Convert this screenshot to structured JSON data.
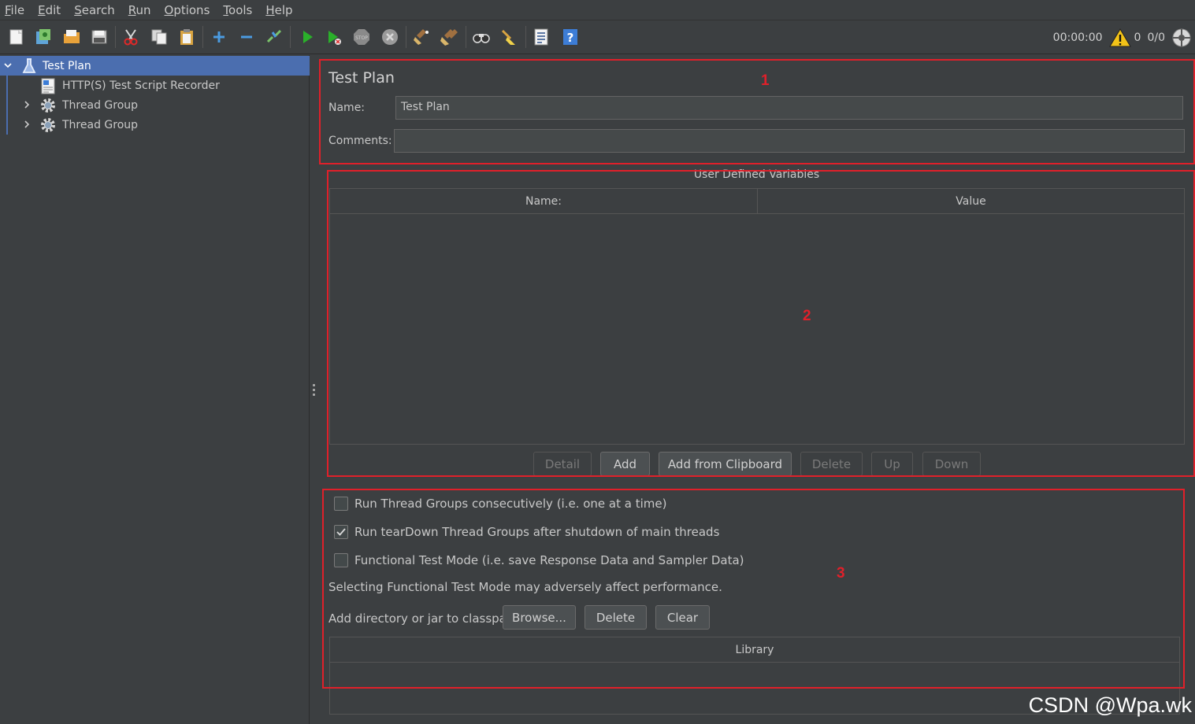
{
  "menu": [
    {
      "mnemonic": "F",
      "rest": "ile"
    },
    {
      "mnemonic": "E",
      "rest": "dit"
    },
    {
      "mnemonic": "S",
      "rest": "earch"
    },
    {
      "mnemonic": "R",
      "rest": "un"
    },
    {
      "mnemonic": "O",
      "rest": "ptions"
    },
    {
      "mnemonic": "T",
      "rest": "ools"
    },
    {
      "mnemonic": "H",
      "rest": "elp"
    }
  ],
  "toolbar": {
    "icons": [
      "new-icon",
      "templates-icon",
      "open-icon",
      "save-icon",
      "cut-icon",
      "copy-icon",
      "paste-icon",
      "expand-icon",
      "collapse-icon",
      "toggle-icon",
      "start-icon",
      "start-no-pause-icon",
      "stop-icon",
      "shutdown-icon",
      "clear-icon",
      "clear-all-icon",
      "search-icon",
      "reset-search-icon",
      "function-helper-icon",
      "help-icon"
    ]
  },
  "status": {
    "timer": "00:00:00",
    "warning_count": "0",
    "threads": "0/0"
  },
  "tree": {
    "items": [
      {
        "label": "Test Plan"
      },
      {
        "label": "HTTP(S) Test Script Recorder"
      },
      {
        "label": "Thread Group"
      },
      {
        "label": "Thread Group"
      }
    ]
  },
  "panel": {
    "title": "Test Plan",
    "name_label": "Name:",
    "name_value": "Test Plan",
    "comments_label": "Comments:",
    "comments_value": ""
  },
  "udv": {
    "title": "User Defined Variables",
    "columns": [
      "Name:",
      "Value"
    ],
    "buttons": {
      "detail": "Detail",
      "add": "Add",
      "add_clipboard": "Add from Clipboard",
      "delete": "Delete",
      "up": "Up",
      "down": "Down"
    }
  },
  "options": {
    "run_consecutively": {
      "label": "Run Thread Groups consecutively (i.e. one at a time)",
      "checked": false
    },
    "run_teardown": {
      "label": "Run tearDown Thread Groups after shutdown of main threads",
      "checked": true
    },
    "functional_mode": {
      "label": "Functional Test Mode (i.e. save Response Data and Sampler Data)",
      "checked": false
    },
    "functional_note": "Selecting Functional Test Mode may adversely affect performance.",
    "classpath_label": "Add directory or jar to classpath",
    "browse": "Browse...",
    "delete": "Delete",
    "clear": "Clear",
    "library_column": "Library"
  },
  "annotations": {
    "box1": "1",
    "box2": "2",
    "box3": "3",
    "color": "#e0202a"
  },
  "watermark": "CSDN @Wpa.wk"
}
